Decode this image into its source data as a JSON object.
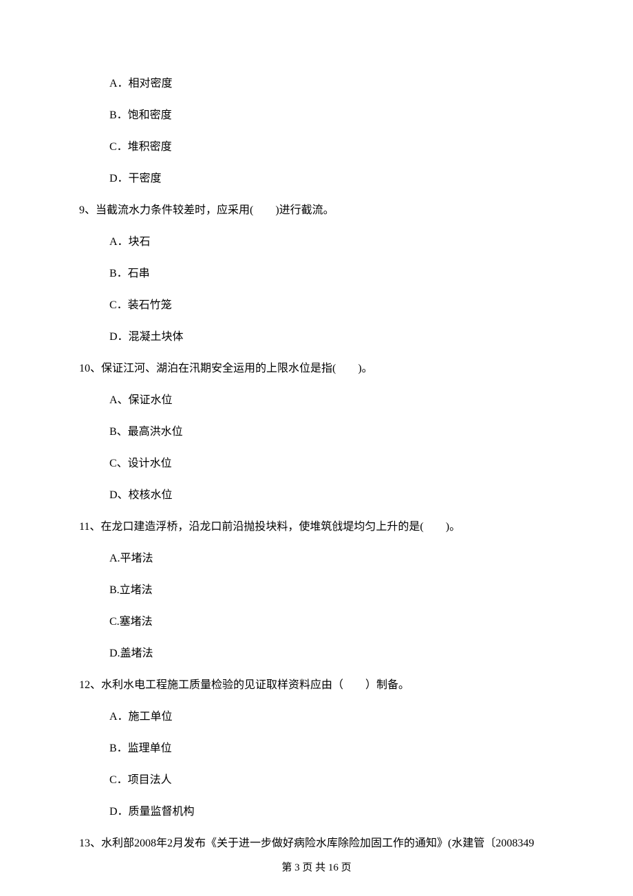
{
  "q8": {
    "A": "A．相对密度",
    "B": "B．饱和密度",
    "C": "C．堆积密度",
    "D": "D．干密度"
  },
  "q9": {
    "stem": "9、当截流水力条件较差时，应采用(　　)进行截流。",
    "A": "A．块石",
    "B": "B．石串",
    "C": "C．装石竹笼",
    "D": "D．混凝土块体"
  },
  "q10": {
    "stem": "10、保证江河、湖泊在汛期安全运用的上限水位是指(　　)。",
    "A": "A、保证水位",
    "B": "B、最高洪水位",
    "C": "C、设计水位",
    "D": "D、校核水位"
  },
  "q11": {
    "stem": "11、在龙口建造浮桥，沿龙口前沿抛投块料，使堆筑戗堤均匀上升的是(　　)。",
    "A": "A.平堵法",
    "B": "B.立堵法",
    "C": "C.塞堵法",
    "D": "D.盖堵法"
  },
  "q12": {
    "stem": "12、水利水电工程施工质量检验的见证取样资料应由（　　）制备。",
    "A": "A．施工单位",
    "B": "B．监理单位",
    "C": "C．项目法人",
    "D": "D．质量监督机构"
  },
  "q13": {
    "stem": "13、水利部2008年2月发布《关于进一步做好病险水库除险加固工作的通知》(水建管〔2008349"
  },
  "footer": "第 3 页 共 16 页"
}
